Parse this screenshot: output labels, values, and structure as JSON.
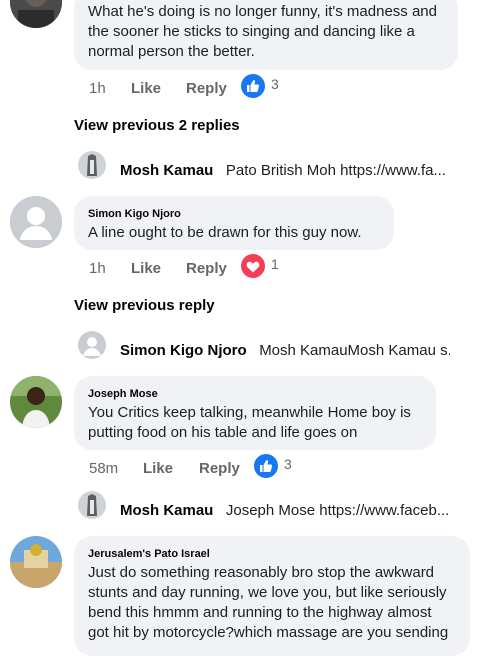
{
  "comment1": {
    "text": "What he's doing is no longer funny, it's madness and the sooner he sticks to singing and dancing like a normal person the better.",
    "time": "1h",
    "like": "Like",
    "reply": "Reply",
    "reaction_icon": "like-icon",
    "reaction_count": "3",
    "view_replies": "View previous 2 replies",
    "reply_preview": {
      "name": "Mosh Kamau",
      "text": "Pato British Moh https://www.fa..."
    }
  },
  "comment2": {
    "author": "Simon Kigo Njoro",
    "text": "A line ought to be drawn for this guy now.",
    "time": "1h",
    "like": "Like",
    "reply": "Reply",
    "reaction_icon": "love-icon",
    "reaction_count": "1",
    "view_replies": "View previous reply",
    "reply_preview": {
      "name": "Simon Kigo Njoro",
      "text": "Mosh KamauMosh Kamau s..."
    }
  },
  "comment3": {
    "author": "Joseph Mose",
    "text": "You Critics keep talking, meanwhile Home boy is putting food on his table and life goes on",
    "time": "58m",
    "like": "Like",
    "reply": "Reply",
    "reaction_icon": "like-icon",
    "reaction_count": "3",
    "reply_preview": {
      "name": "Mosh Kamau",
      "text": "Joseph Mose https://www.faceb..."
    }
  },
  "comment4": {
    "author": "Jerusalem's Pato Israel",
    "text": "Just do something reasonably bro stop the awkward stunts and day running, we love you, but like seriously bend this hmmm and running to the highway almost got hit by motorcycle?which massage are you sending"
  },
  "colors": {
    "bubble": "#f0f2f5",
    "like_blue": "#1877f2",
    "love_red": "#f33e58",
    "meta_gray": "#65676b"
  }
}
